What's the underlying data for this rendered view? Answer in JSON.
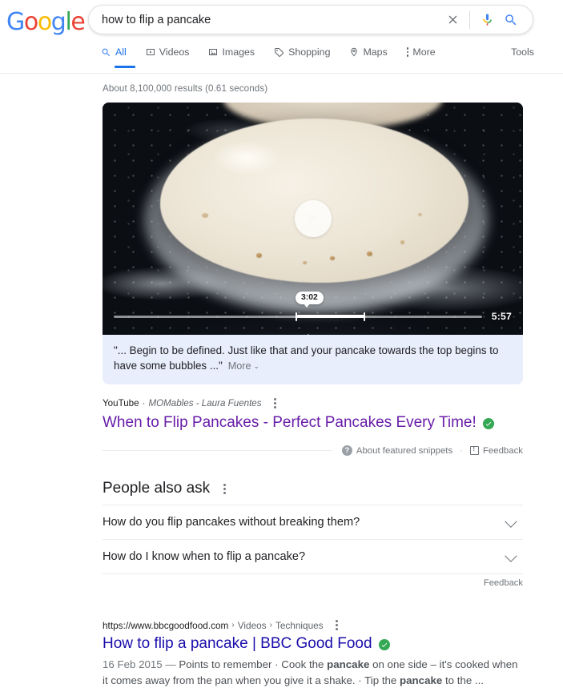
{
  "brand": {
    "name": "Google",
    "letters": [
      "G",
      "o",
      "o",
      "g",
      "l",
      "e"
    ],
    "colors": {
      "blue": "#4285f4",
      "red": "#ea4335",
      "yellow": "#fbbc05",
      "green": "#34a853",
      "link_blue": "#1a0dab",
      "link_visited": "#681da8",
      "accent": "#1a73e8"
    }
  },
  "search": {
    "query": "how to flip a pancake",
    "placeholder": "Search",
    "clear_icon": "close-icon",
    "voice_icon": "microphone-icon",
    "submit_icon": "search-icon"
  },
  "tabs": [
    {
      "label": "All",
      "icon": "search-icon",
      "active": true
    },
    {
      "label": "Videos",
      "icon": "video-icon",
      "active": false
    },
    {
      "label": "Images",
      "icon": "image-icon",
      "active": false
    },
    {
      "label": "Shopping",
      "icon": "tag-icon",
      "active": false
    },
    {
      "label": "Maps",
      "icon": "pin-icon",
      "active": false
    },
    {
      "label": "More",
      "icon": "kebab-icon",
      "active": false
    }
  ],
  "tools_label": "Tools",
  "stats": "About 8,100,000 results (0.61 seconds)",
  "featured_video": {
    "current_time": "3:02",
    "duration": "5:57",
    "play_icon": "play-icon",
    "progress_percent": 50,
    "highlight_start_percent": 49.5,
    "highlight_end_percent": 68,
    "snippet_quote": "\"... Begin to be defined. Just like that and your pancake towards the top begins to have some bubbles ...\"",
    "more_label": "More",
    "more_chevron": "chevron-down-icon",
    "panel_color": "#e9eefc"
  },
  "video_result": {
    "source": "YouTube",
    "separator": "·",
    "channel": "MOMables - Laura Fuentes",
    "menu_icon": "kebab-icon",
    "title": "When to Flip Pancakes - Perfect Pancakes Every Time!",
    "verified_icon": "verified-check-icon",
    "title_color": "#681da8"
  },
  "snippet_footer": {
    "help_icon": "question-mark-icon",
    "about_label": "About featured snippets",
    "dot": "·",
    "feedback_icon": "feedback-icon",
    "feedback_label": "Feedback"
  },
  "people_also_ask": {
    "heading": "People also ask",
    "menu_icon": "kebab-icon",
    "questions": [
      {
        "text": "How do you flip pancakes without breaking them?",
        "chevron": "chevron-down-icon"
      },
      {
        "text": "How do I know when to flip a pancake?",
        "chevron": "chevron-down-icon"
      }
    ],
    "feedback_label": "Feedback"
  },
  "organic_result": {
    "url": "https://www.bbcgoodfood.com",
    "breadcrumbs": [
      "Videos",
      "Techniques"
    ],
    "crumb_arrow": "›",
    "menu_icon": "kebab-icon",
    "title": "How to flip a pancake | BBC Good Food",
    "verified_icon": "verified-check-icon",
    "title_color": "#1a0dab",
    "date": "16 Feb 2015",
    "dash": "—",
    "description_part1": "Points to remember · Cook the ",
    "bold1": "pancake",
    "description_part2": " on one side – it's cooked when it comes away from the pan when you give it a shake. · Tip the ",
    "bold2": "pancake",
    "description_part3": " to the ..."
  }
}
